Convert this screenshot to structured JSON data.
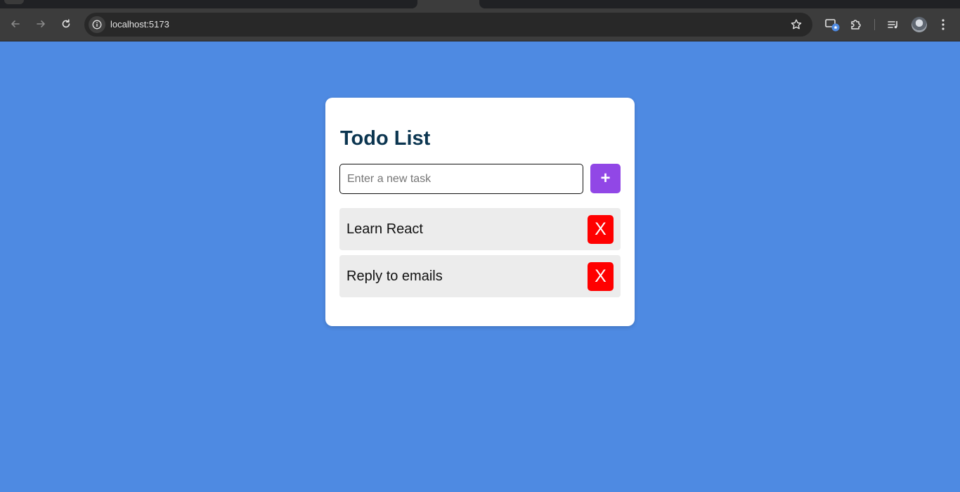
{
  "browser": {
    "url": "localhost:5173",
    "icons": [
      "back-arrow-icon",
      "forward-arrow-icon",
      "reload-icon",
      "info-icon",
      "bookmark-star-icon",
      "cast-icon",
      "extensions-puzzle-icon",
      "media-queue-icon",
      "profile-avatar",
      "kebab-menu-icon"
    ]
  },
  "app": {
    "title": "Todo List",
    "input": {
      "placeholder": "Enter a new task",
      "value": ""
    },
    "add_label": "+",
    "delete_label": "X",
    "items": [
      {
        "text": "Learn React"
      },
      {
        "text": "Reply to emails"
      }
    ]
  },
  "colors": {
    "page_background": "#4e8ae2",
    "title": "#0b3550",
    "add_button": "#9147e6",
    "delete_button": "#ff0000",
    "item_background": "#ececec"
  }
}
